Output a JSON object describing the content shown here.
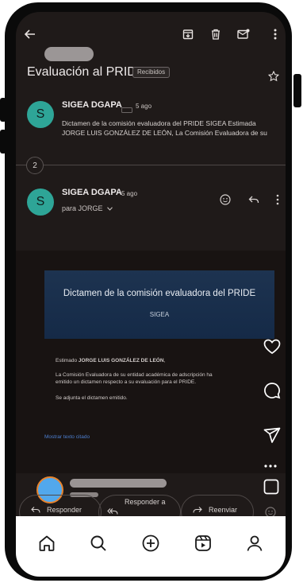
{
  "toolbar": {
    "icons": [
      "arrow-left-icon",
      "archive-icon",
      "trash-icon",
      "mark-unread-icon",
      "more-vert-icon"
    ]
  },
  "thread": {
    "subject": "Evaluación al PRIDE",
    "label": "Recibidos",
    "collapsed_count": "2"
  },
  "message1": {
    "avatar_letter": "S",
    "sender": "SIGEA DGAPA",
    "time": "5 ago",
    "snippet_line1": "Dictamen de la comisión evaluadora del PRIDE SIGEA Estimada",
    "snippet_line2": "JORGE LUIS GONZÁLEZ DE LEÓN, La Comisión Evaluadora de su"
  },
  "message2": {
    "avatar_letter": "S",
    "sender": "SIGEA DGAPA",
    "time": "5 ago",
    "to": "para JORGE"
  },
  "email_body": {
    "banner_title": "Dictamen de la comisión evaluadora del PRIDE",
    "banner_subtitle": "SIGEA",
    "greeting_prefix": "Estimado ",
    "greeting_name": "JORGE LUIS GONZÁLEZ DE LEÓN",
    "greeting_suffix": ",",
    "paragraph_line1": "La Comisión Evaluadora de su entidad académica de adscripción ha",
    "paragraph_line2": "emitido un dictamen respecto a su evaluación para el PRIDE.",
    "attached_note": "Se adjunta el dictamen emitido.",
    "show_quoted": "Mostrar texto citado"
  },
  "reply_actions": {
    "reply": "Responder",
    "reply_all": "Responder a",
    "forward": "Reenviar"
  },
  "colors": {
    "screen_bg": "#1f1a19",
    "avatar": "#2ea597",
    "banner": "#1d3350",
    "link": "#4d7fd0",
    "story_avatar": "#52a8ec",
    "story_ring": "#e8842e"
  },
  "bottom_nav": [
    "home-icon",
    "search-icon",
    "create-icon",
    "reels-icon",
    "profile-icon"
  ]
}
